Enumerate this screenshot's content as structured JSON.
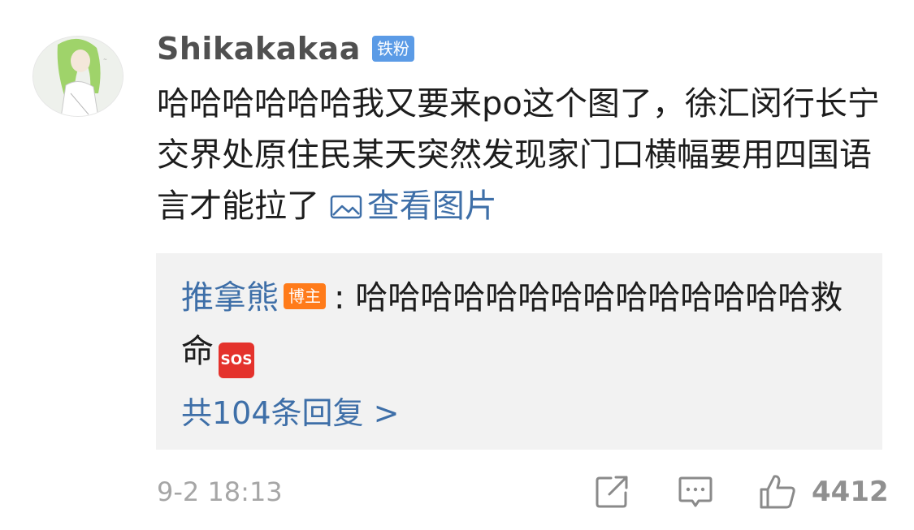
{
  "comment": {
    "username": "Shikakakaa",
    "badge": "铁粉",
    "text": "哈哈哈哈哈哈我又要来po这个图了，徐汇闵行长宁交界处原住民某天突然发现家门口横幅要用四国语言才能拉了",
    "view_image_label": "查看图片"
  },
  "reply": {
    "author": "推拿熊",
    "badge": "博主",
    "separator": ":",
    "text": "哈哈哈哈哈哈哈哈哈哈哈哈哈哈救命",
    "emoji_label": "SOS",
    "more_label": "共104条回复 >"
  },
  "footer": {
    "timestamp": "9-2 18:13",
    "like_count": "4412"
  },
  "icons": {
    "avatar": "avatar",
    "image": "image-icon",
    "share": "share-icon",
    "reply": "comment-icon",
    "like": "thumbs-up-icon"
  },
  "colors": {
    "link_blue": "#3e6fa8",
    "fan_badge": "#5b9be6",
    "host_badge": "#ff7b1a",
    "sos": "#e4322c",
    "muted": "#a6a6a6"
  }
}
